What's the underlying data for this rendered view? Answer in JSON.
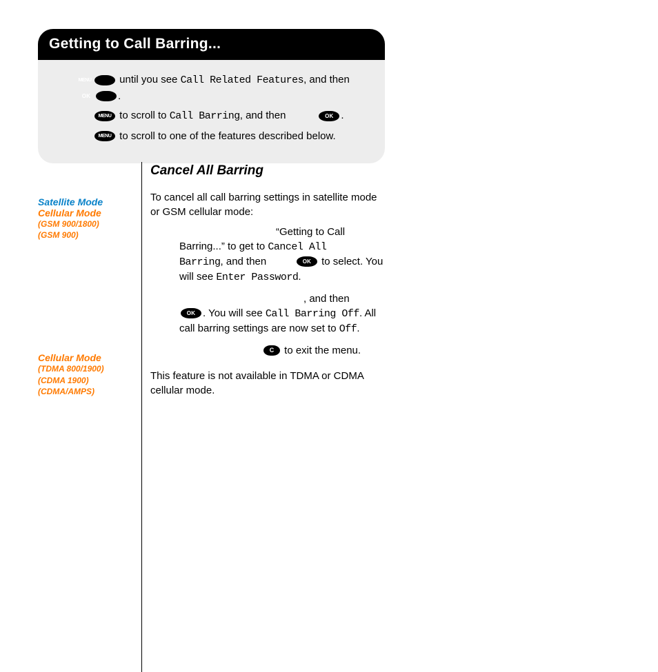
{
  "quickMenu": {
    "title": "Getting to Call Barring...",
    "line1a": " until you see ",
    "line1b": "Call Related Features",
    "line1c": ", and then",
    "line1d": ".",
    "line2a": " to scroll to ",
    "line2b": "Call Barring",
    "line2c": ", and then           ",
    "line2d": ".",
    "line3": " to scroll to one of the features described below."
  },
  "buttons": {
    "menu": "MENU",
    "ok": "OK",
    "c": "C"
  },
  "side1": {
    "sat": "Satellite Mode",
    "cell": "Cellular Mode",
    "t1": "(GSM 900/1800)",
    "t2": "(GSM 900)"
  },
  "side2": {
    "cell": "Cellular Mode",
    "t1": "(TDMA 800/1900)",
    "t2": "(CDMA 1900)",
    "t3": "(CDMA/AMPS)"
  },
  "body": {
    "sectionTitle": "Cancel All Barring",
    "intro": "To cancel all call barring settings in satellite mode or GSM cellular mode:",
    "s1a": "“Getting to Call",
    "s1b": "Barring...” to get to ",
    "s1c": "Cancel All Barring",
    "s1d": ", and then          ",
    "s1e": " to select. You will see ",
    "s1f": "Enter Password",
    "s1g": ".",
    "s2a": ", and then          ",
    "s2b": ". You will see ",
    "s2c": "Call Barring Off",
    "s2d": ". All call barring settings are now set to ",
    "s2e": "Off",
    "s2f": ".",
    "s3a": " to exit the menu.",
    "notAvail": "This feature is not available in TDMA or CDMA cellular mode."
  }
}
